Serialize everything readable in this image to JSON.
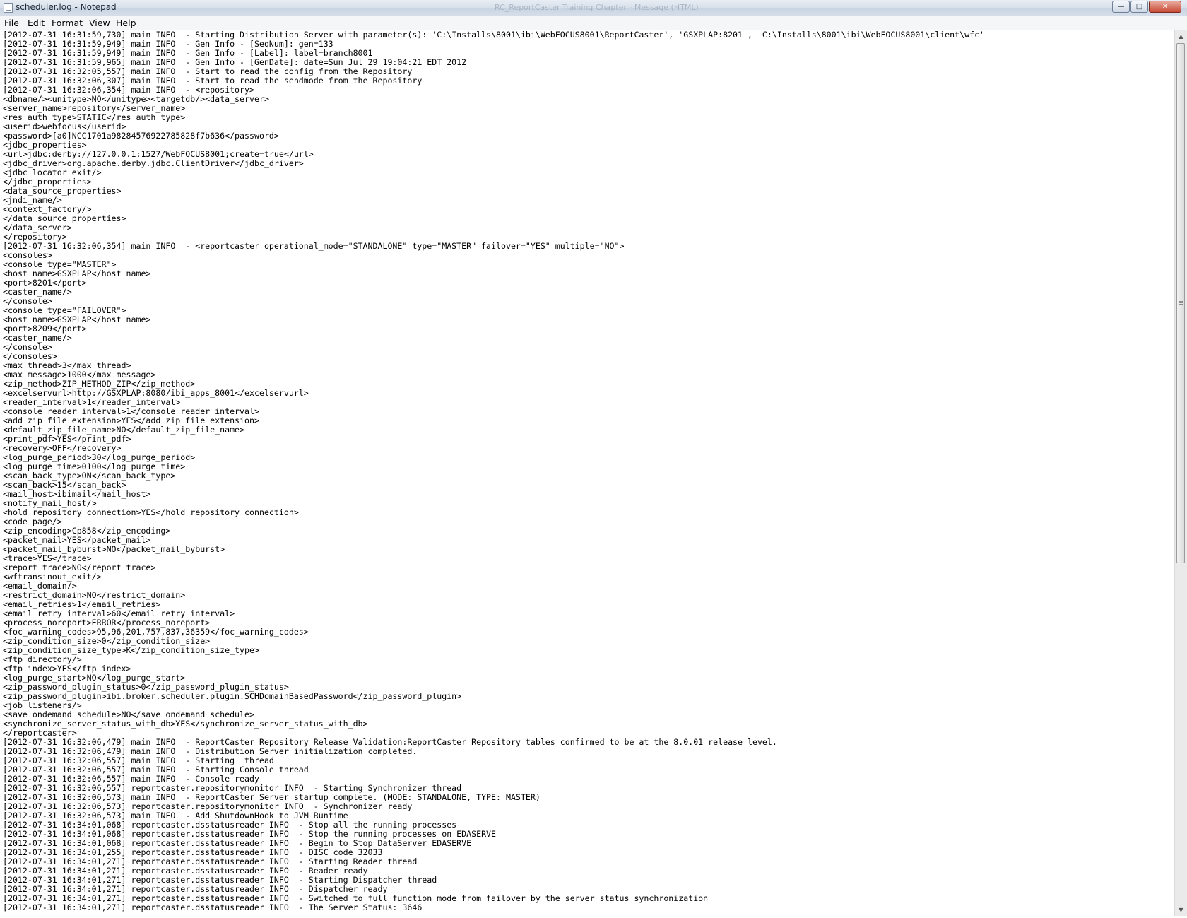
{
  "window": {
    "title": "scheduler.log - Notepad",
    "background_title": "RC_ReportCaster Training Chapter - Message (HTML)",
    "controls": {
      "minimize": "—",
      "maximize": "□",
      "close": "✕"
    }
  },
  "menu": {
    "file": "File",
    "edit": "Edit",
    "format": "Format",
    "view": "View",
    "help": "Help"
  },
  "editor": {
    "lines": [
      "[2012-07-31 16:31:59,730] main INFO  - Starting Distribution Server with parameter(s): 'C:\\Installs\\8001\\ibi\\WebFOCUS8001\\ReportCaster', 'GSXPLAP:8201', 'C:\\Installs\\8001\\ibi\\WebFOCUS8001\\client\\wfc'",
      "[2012-07-31 16:31:59,949] main INFO  - Gen Info - [SeqNum]: gen=133",
      "[2012-07-31 16:31:59,949] main INFO  - Gen Info - [Label]: label=branch8001",
      "[2012-07-31 16:31:59,965] main INFO  - Gen Info - [GenDate]: date=Sun Jul 29 19:04:21 EDT 2012",
      "[2012-07-31 16:32:05,557] main INFO  - Start to read the config from the Repository",
      "[2012-07-31 16:32:06,307] main INFO  - Start to read the sendmode from the Repository",
      "[2012-07-31 16:32:06,354] main INFO  - <repository>",
      "<dbname/><unitype>NO</unitype><targetdb/><data_server>",
      "<server_name>repository</server_name>",
      "<res_auth_type>STATIC</res_auth_type>",
      "<userid>webfocus</userid>",
      "<password>[a0]NCC1701a98284576922785828f7b636</password>",
      "<jdbc_properties>",
      "<url>jdbc:derby://127.0.0.1:1527/WebFOCUS8001;create=true</url>",
      "<jdbc_driver>org.apache.derby.jdbc.ClientDriver</jdbc_driver>",
      "<jdbc_locator_exit/>",
      "</jdbc_properties>",
      "<data_source_properties>",
      "<jndi_name/>",
      "<context_factory/>",
      "</data_source_properties>",
      "</data_server>",
      "</repository>",
      "[2012-07-31 16:32:06,354] main INFO  - <reportcaster operational_mode=\"STANDALONE\" type=\"MASTER\" failover=\"YES\" multiple=\"NO\">",
      "<consoles>",
      "<console type=\"MASTER\">",
      "<host_name>GSXPLAP</host_name>",
      "<port>8201</port>",
      "<caster_name/>",
      "</console>",
      "<console type=\"FAILOVER\">",
      "<host_name>GSXPLAP</host_name>",
      "<port>8209</port>",
      "<caster_name/>",
      "</console>",
      "</consoles>",
      "<max_thread>3</max_thread>",
      "<max_message>1000</max_message>",
      "<zip_method>ZIP_METHOD_ZIP</zip_method>",
      "<excelservurl>http://GSXPLAP:8080/ibi_apps_8001</excelservurl>",
      "<reader_interval>1</reader_interval>",
      "<console_reader_interval>1</console_reader_interval>",
      "<add_zip_file_extension>YES</add_zip_file_extension>",
      "<default_zip_file_name>NO</default_zip_file_name>",
      "<print_pdf>YES</print_pdf>",
      "<recovery>OFF</recovery>",
      "<log_purge_period>30</log_purge_period>",
      "<log_purge_time>0100</log_purge_time>",
      "<scan_back_type>ON</scan_back_type>",
      "<scan_back>15</scan_back>",
      "<mail_host>ibimail</mail_host>",
      "<notify_mail_host/>",
      "<hold_repository_connection>YES</hold_repository_connection>",
      "<code_page/>",
      "<zip_encoding>Cp858</zip_encoding>",
      "<packet_mail>YES</packet_mail>",
      "<packet_mail_byburst>NO</packet_mail_byburst>",
      "<trace>YES</trace>",
      "<report_trace>NO</report_trace>",
      "<wftransinout_exit/>",
      "<email_domain/>",
      "<restrict_domain>NO</restrict_domain>",
      "<email_retries>1</email_retries>",
      "<email_retry_interval>60</email_retry_interval>",
      "<process_noreport>ERROR</process_noreport>",
      "<foc_warning_codes>95,96,201,757,837,36359</foc_warning_codes>",
      "<zip_condition_size>0</zip_condition_size>",
      "<zip_condition_size_type>K</zip_condition_size_type>",
      "<ftp_directory/>",
      "<ftp_index>YES</ftp_index>",
      "<log_purge_start>NO</log_purge_start>",
      "<zip_password_plugin_status>0</zip_password_plugin_status>",
      "<zip_password_plugin>ibi.broker.scheduler.plugin.SCHDomainBasedPassword</zip_password_plugin>",
      "<job_listeners/>",
      "<save_ondemand_schedule>NO</save_ondemand_schedule>",
      "<synchronize_server_status_with_db>YES</synchronize_server_status_with_db>",
      "</reportcaster>",
      "[2012-07-31 16:32:06,479] main INFO  - ReportCaster Repository Release Validation:ReportCaster Repository tables confirmed to be at the 8.0.01 release level.",
      "[2012-07-31 16:32:06,479] main INFO  - Distribution Server initialization completed.",
      "[2012-07-31 16:32:06,557] main INFO  - Starting  thread",
      "[2012-07-31 16:32:06,557] main INFO  - Starting Console thread",
      "[2012-07-31 16:32:06,557] main INFO  - Console ready",
      "[2012-07-31 16:32:06,557] reportcaster.repositorymonitor INFO  - Starting Synchronizer thread",
      "[2012-07-31 16:32:06,573] main INFO  - ReportCaster Server startup complete. (MODE: STANDALONE, TYPE: MASTER)",
      "[2012-07-31 16:32:06,573] reportcaster.repositorymonitor INFO  - Synchronizer ready",
      "[2012-07-31 16:32:06,573] main INFO  - Add ShutdownHook to JVM Runtime",
      "[2012-07-31 16:34:01,068] reportcaster.dsstatusreader INFO  - Stop all the running processes",
      "[2012-07-31 16:34:01,068] reportcaster.dsstatusreader INFO  - Stop the running processes on EDASERVE",
      "[2012-07-31 16:34:01,068] reportcaster.dsstatusreader INFO  - Begin to Stop DataServer EDASERVE",
      "[2012-07-31 16:34:01,255] reportcaster.dsstatusreader INFO  - DISC code 32033",
      "[2012-07-31 16:34:01,271] reportcaster.dsstatusreader INFO  - Starting Reader thread",
      "[2012-07-31 16:34:01,271] reportcaster.dsstatusreader INFO  - Reader ready",
      "[2012-07-31 16:34:01,271] reportcaster.dsstatusreader INFO  - Starting Dispatcher thread",
      "[2012-07-31 16:34:01,271] reportcaster.dsstatusreader INFO  - Dispatcher ready",
      "[2012-07-31 16:34:01,271] reportcaster.dsstatusreader INFO  - Switched to full function mode from failover by the server status synchronization",
      "[2012-07-31 16:34:01,271] reportcaster.dsstatusreader INFO  - The Server Status: 3646"
    ]
  },
  "scrollbar": {
    "up_arrow": "▲",
    "down_arrow": "▼"
  }
}
